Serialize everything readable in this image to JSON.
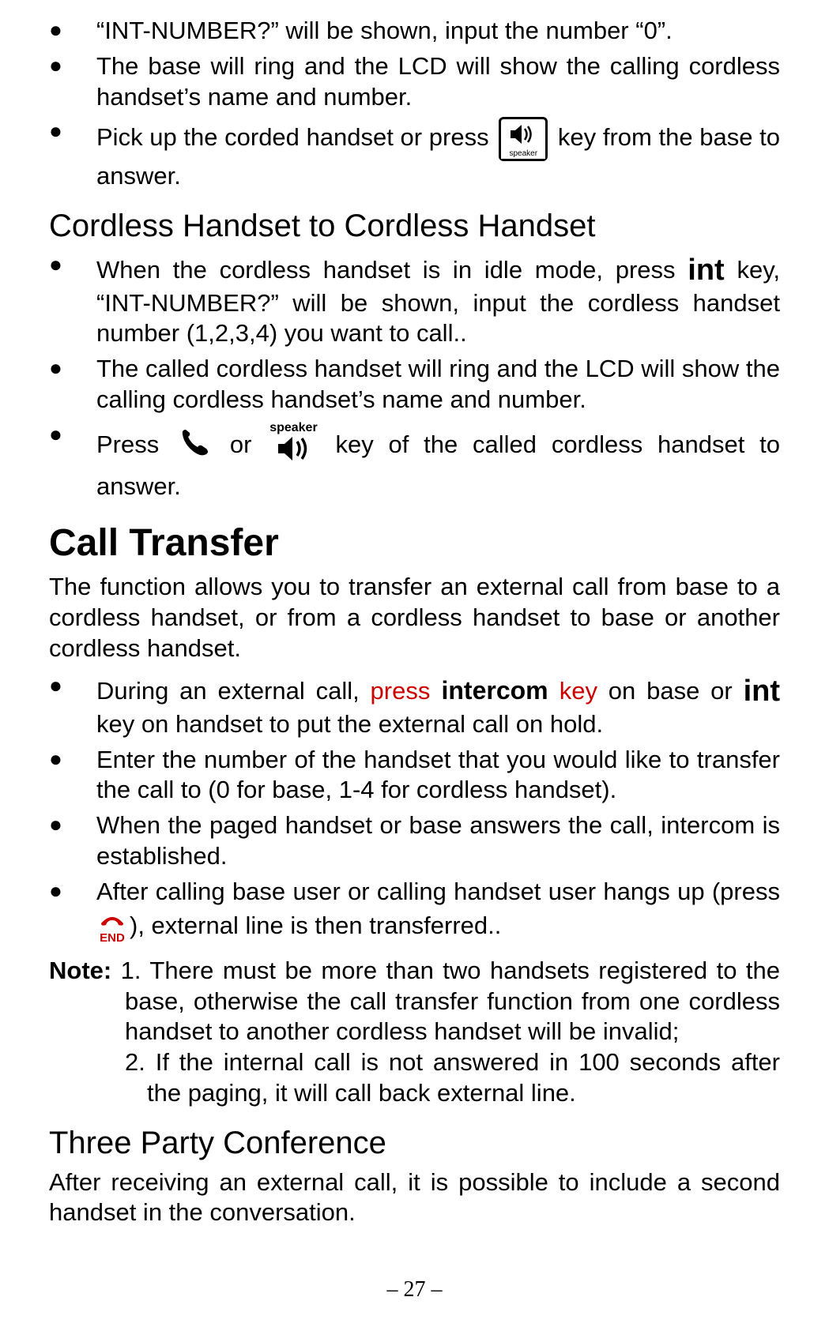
{
  "frag_top": {
    "li1": "“INT-NUMBER?” will be shown, input the number “0”.",
    "li2": "The base will ring and the LCD will show the calling cordless handset’s name and number.",
    "li3a": "Pick up the corded handset or press ",
    "li3b": " key from the base to answer."
  },
  "sec_chch": {
    "title": "Cordless Handset to Cordless Handset",
    "li1a": "When the cordless handset is in idle mode, press ",
    "li1b": " key, “INT-NUMBER?” will be shown, input the cordless handset number (1,2,3,4) you want to call..",
    "li2": "The called cordless handset will ring and the LCD will show the calling cordless handset’s name and number.",
    "li3a": "Press  ",
    "li3b": " or ",
    "li3c": "  key of the called cordless handset to answer."
  },
  "sec_ct": {
    "title": "Call Transfer",
    "intro": "The function allows you to transfer an external call from base to a cordless handset, or from a cordless handset to base or another cordless handset.",
    "li1a": "During an external call, ",
    "li1_press": "press",
    "li1_intercom": " intercom ",
    "li1_key": "key",
    "li1b": " on base or ",
    "li1c": " key on handset to put the external call on hold.",
    "li2": "Enter the number of the handset that you would like to transfer the call to (0 for base, 1-4 for cordless handset).",
    "li3": "When the paged handset or base answers the call, intercom is established.",
    "li4a": "After calling base user or calling handset user hangs up (press ",
    "li4b": "),   external line is then transferred.."
  },
  "note": {
    "label": "Note: ",
    "n1": "1. There must be more than two handsets registered to the base, otherwise the call transfer function from one cordless handset to another cordless handset will be invalid;",
    "n2": "2. If the internal call is not answered in 100 seconds after the paging, it will call back external line."
  },
  "sec_3p": {
    "title": "Three Party Conference",
    "intro": "After receiving an external call, it is possible to include a second handset in the conversation."
  },
  "keys": {
    "int": "int",
    "speaker_label": "speaker",
    "base_speaker_label": "speaker",
    "end_label": "END"
  },
  "page_number": "– 27 –"
}
